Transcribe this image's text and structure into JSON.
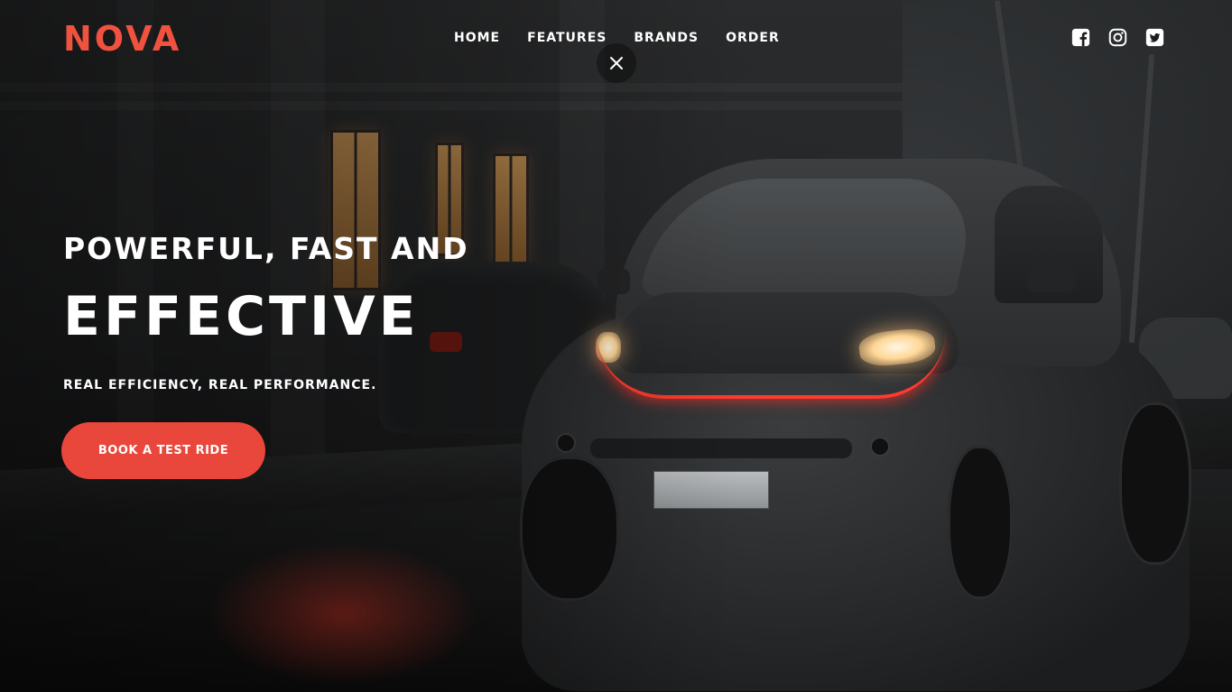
{
  "brand": {
    "logo_text": "NOVA",
    "accent_color": "#f0523f"
  },
  "nav": {
    "items": [
      {
        "label": "HOME"
      },
      {
        "label": "FEATURES"
      },
      {
        "label": "BRANDS"
      },
      {
        "label": "ORDER"
      }
    ],
    "close_icon": "close-icon"
  },
  "socials": [
    {
      "icon": "facebook-icon"
    },
    {
      "icon": "instagram-icon"
    },
    {
      "icon": "twitter-icon"
    }
  ],
  "hero": {
    "headline_line1": "POWERFUL, FAST AND",
    "headline_line2": "EFFECTIVE",
    "tagline": "REAL EFFICIENCY, REAL PERFORMANCE.",
    "cta_label": "BOOK A TEST RIDE",
    "cta_color": "#e9473b"
  }
}
